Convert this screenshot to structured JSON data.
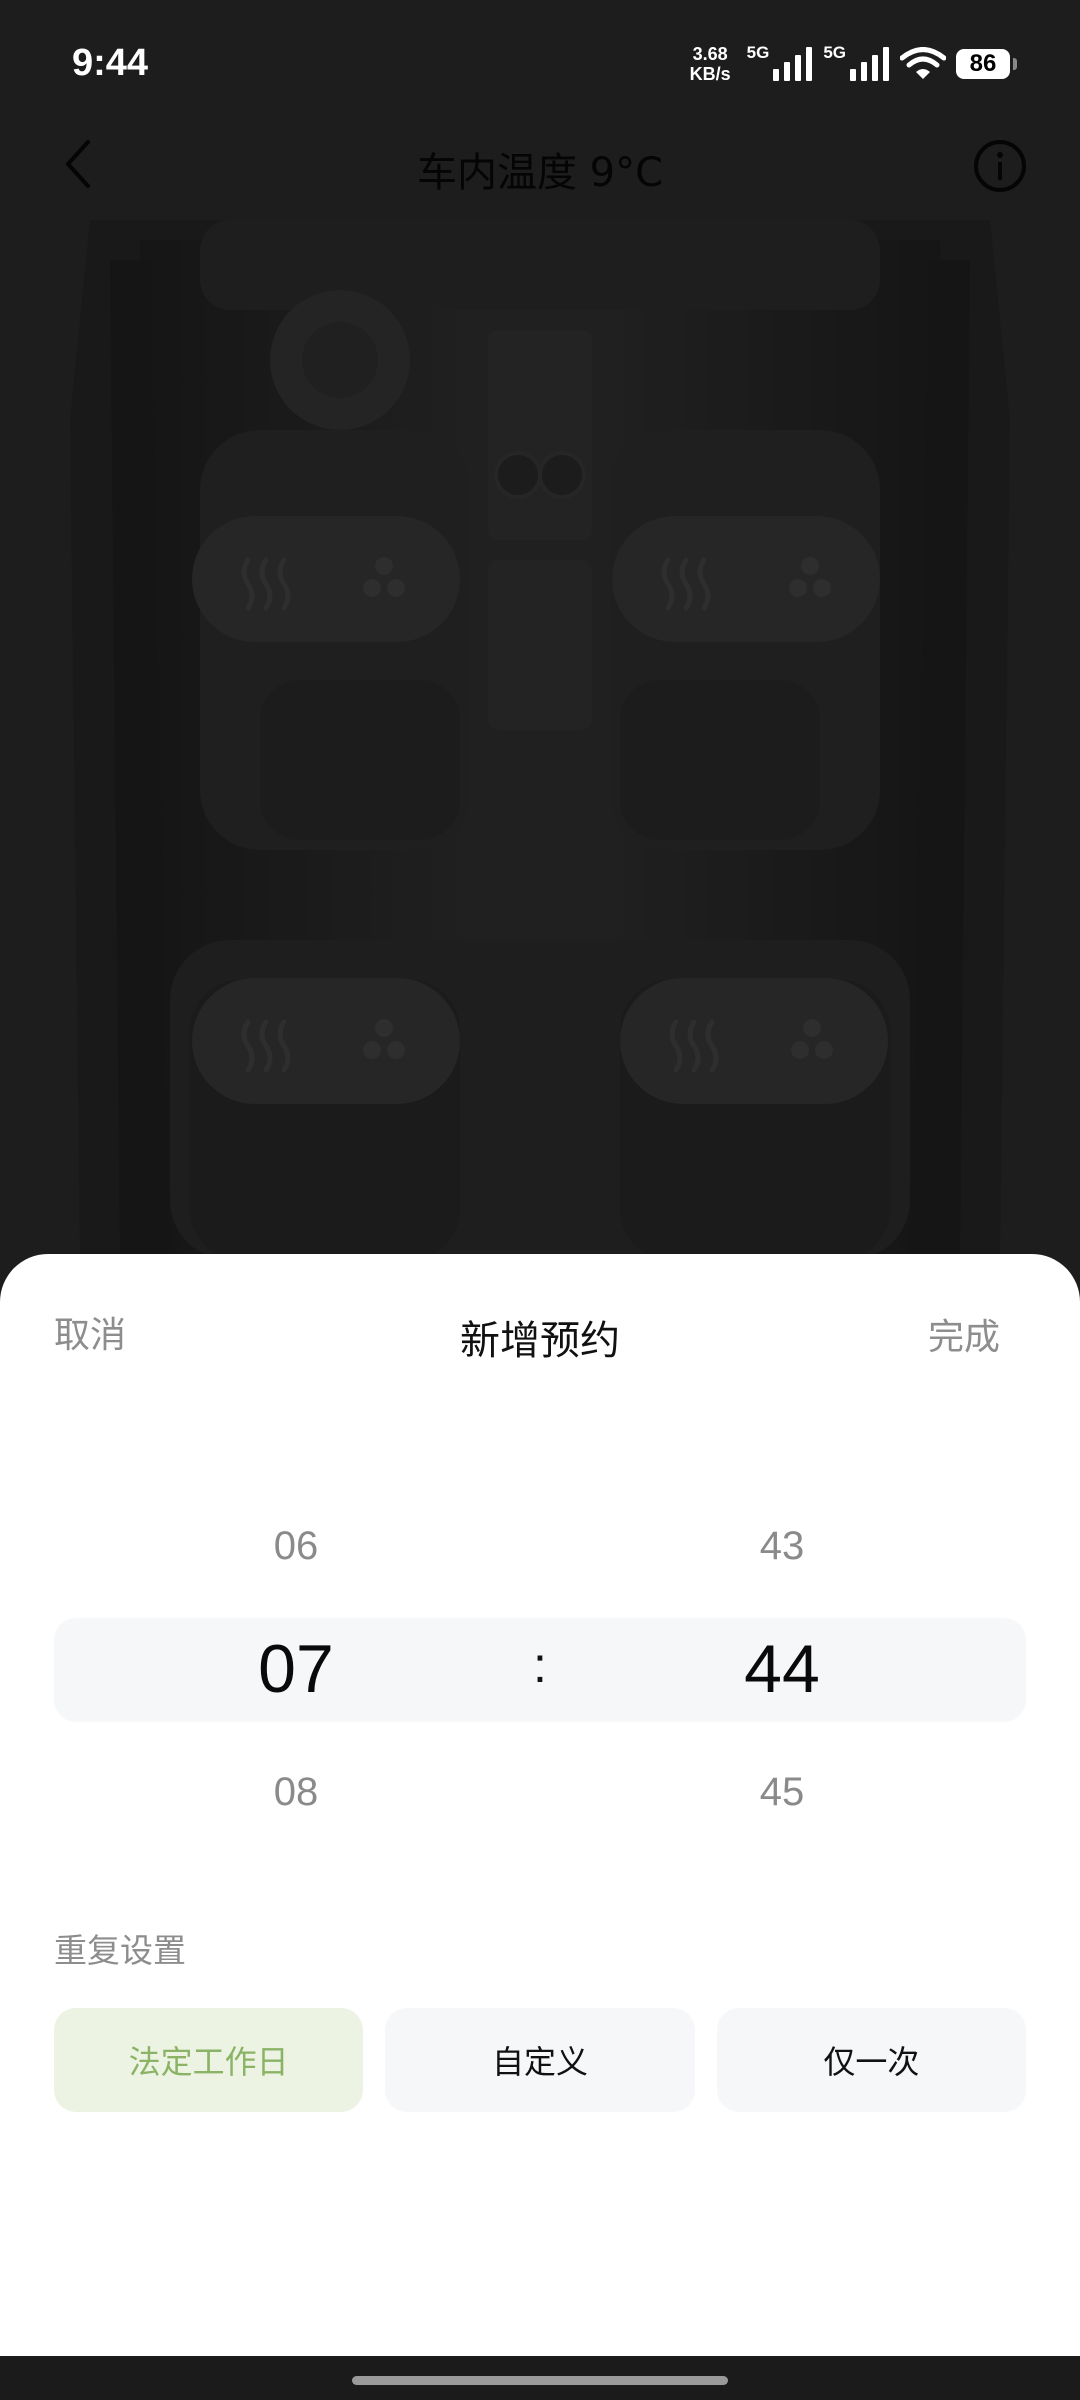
{
  "status_bar": {
    "time": "9:44",
    "net_speed_value": "3.68",
    "net_speed_unit": "KB/s",
    "sim1_label": "5G",
    "sim2_label": "5G",
    "battery": "86",
    "icons": [
      "signal-icon",
      "signal-icon",
      "wifi-icon",
      "battery-icon"
    ]
  },
  "header": {
    "title": "车内温度 9°C",
    "back_icon": "chevron-left-icon",
    "info_icon": "info-icon"
  },
  "sheet": {
    "cancel_label": "取消",
    "title": "新增预约",
    "done_label": "完成",
    "picker": {
      "hours": {
        "prev": "06",
        "selected": "07",
        "next": "08"
      },
      "separator": ":",
      "minutes": {
        "prev": "43",
        "selected": "44",
        "next": "45"
      }
    },
    "repeat_label": "重复设置",
    "repeat_options": [
      {
        "label": "法定工作日",
        "selected": true
      },
      {
        "label": "自定义",
        "selected": false
      },
      {
        "label": "仅一次",
        "selected": false
      }
    ]
  },
  "colors": {
    "accent": "#8bb366",
    "accent_bg": "#edf3e3",
    "overlay": "#1d1d1d",
    "sheet_bg": "#ffffff"
  }
}
